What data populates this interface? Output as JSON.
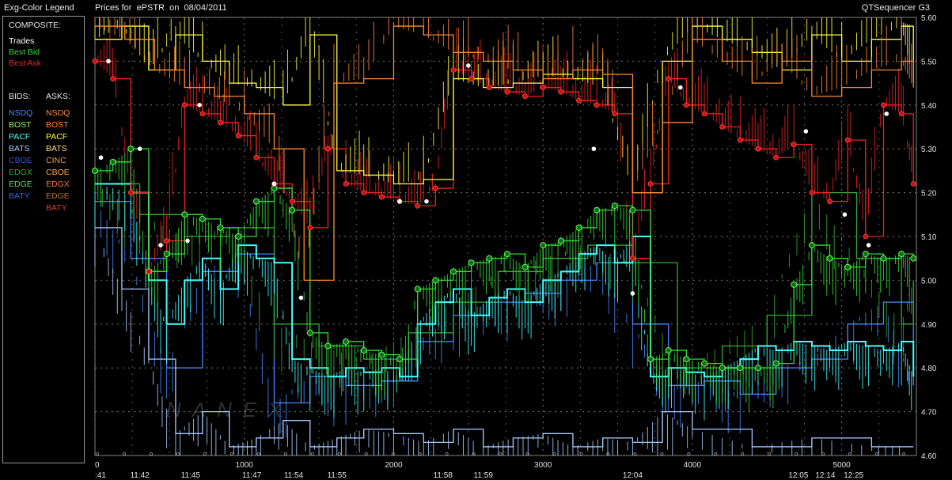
{
  "header": {
    "legend_title": "Exg-Color Legend",
    "chart_title": "Prices for  ePSTR  on  08/04/2011",
    "app_name": "QTSequencer G3"
  },
  "legend": {
    "composite_label": "COMPOSITE:",
    "composite": [
      {
        "label": "Trades",
        "color": "#ffffff"
      },
      {
        "label": "Best Bid",
        "color": "#33dd33"
      },
      {
        "label": "Best Ask",
        "color": "#ee2222"
      }
    ],
    "bids_label": "BIDS:",
    "asks_label": "ASKS:",
    "bids": [
      {
        "label": "NSDQ",
        "color": "#4488ff"
      },
      {
        "label": "BOST",
        "color": "#99ff66"
      },
      {
        "label": "PACF",
        "color": "#44ffff"
      },
      {
        "label": "BATS",
        "color": "#aaccff"
      },
      {
        "label": "CBOE",
        "color": "#3355cc"
      },
      {
        "label": "EDGX",
        "color": "#33aa33"
      },
      {
        "label": "EDGE",
        "color": "#55dd55"
      },
      {
        "label": "BATY",
        "color": "#3366dd"
      }
    ],
    "asks": [
      {
        "label": "NSDQ",
        "color": "#ff8833"
      },
      {
        "label": "BOST",
        "color": "#ff8855"
      },
      {
        "label": "PACF",
        "color": "#ffff44"
      },
      {
        "label": "BATS",
        "color": "#ffdd88"
      },
      {
        "label": "CINC",
        "color": "#ee9944"
      },
      {
        "label": "CBOE",
        "color": "#ffaa44"
      },
      {
        "label": "EDGX",
        "color": "#ee7744"
      },
      {
        "label": "EDGE",
        "color": "#dd6633"
      },
      {
        "label": "BATY",
        "color": "#cc4433"
      }
    ]
  },
  "watermark": "NANEX",
  "chart_data": {
    "type": "line",
    "title": "Prices for  ePSTR  on  08/04/2011",
    "ylim": [
      4.6,
      5.6
    ],
    "xlim": [
      0,
      5500
    ],
    "y_ticks": [
      "5.60",
      "5.50",
      "5.40",
      "5.30",
      "5.20",
      "5.10",
      "5.00",
      "4.90",
      "4.80",
      "4.70",
      "4.60"
    ],
    "x_ticks": [
      {
        "value": 0,
        "label": "0"
      },
      {
        "value": 1000,
        "label": "1000"
      },
      {
        "value": 2000,
        "label": "2000"
      },
      {
        "value": 3000,
        "label": "3000"
      },
      {
        "value": 4000,
        "label": "4000"
      },
      {
        "value": 5000,
        "label": "5000"
      }
    ],
    "time_labels": [
      {
        "x": 0,
        "label": ":41"
      },
      {
        "x": 300,
        "label": "11:42"
      },
      {
        "x": 640,
        "label": "11:45"
      },
      {
        "x": 1050,
        "label": "11:47"
      },
      {
        "x": 1330,
        "label": "11:54"
      },
      {
        "x": 1620,
        "label": "11:55"
      },
      {
        "x": 2330,
        "label": "11:58"
      },
      {
        "x": 2600,
        "label": "11:59"
      },
      {
        "x": 3600,
        "label": "12:04"
      },
      {
        "x": 4710,
        "label": "12:05"
      },
      {
        "x": 4890,
        "label": "12:14"
      },
      {
        "x": 5080,
        "label": "12:25"
      }
    ],
    "series": [
      {
        "name": "Best Ask",
        "color": "#ee2222",
        "x": [
          0,
          120,
          240,
          360,
          480,
          600,
          720,
          840,
          960,
          1080,
          1200,
          1320,
          1440,
          1560,
          1680,
          1800,
          1920,
          2040,
          2160,
          2280,
          2400,
          2520,
          2640,
          2760,
          2880,
          3000,
          3120,
          3240,
          3360,
          3480,
          3600,
          3720,
          3840,
          3960,
          4080,
          4200,
          4320,
          4440,
          4560,
          4680,
          4800,
          4920,
          5040,
          5160,
          5280,
          5400,
          5480
        ],
        "y": [
          5.5,
          5.46,
          5.2,
          5.02,
          5.09,
          5.4,
          5.38,
          5.36,
          5.33,
          5.28,
          5.22,
          5.18,
          5.12,
          5.3,
          5.22,
          5.2,
          5.19,
          5.18,
          5.17,
          5.21,
          5.48,
          5.46,
          5.44,
          5.43,
          5.42,
          5.44,
          5.43,
          5.41,
          5.4,
          5.38,
          5.05,
          5.22,
          5.46,
          5.4,
          5.38,
          5.35,
          5.32,
          5.3,
          5.28,
          5.31,
          5.2,
          5.18,
          5.32,
          5.1,
          5.4,
          5.38,
          5.22
        ]
      },
      {
        "name": "Best Bid",
        "color": "#33dd33",
        "x": [
          0,
          120,
          240,
          360,
          480,
          600,
          720,
          840,
          960,
          1080,
          1200,
          1320,
          1440,
          1560,
          1680,
          1800,
          1920,
          2040,
          2160,
          2280,
          2400,
          2520,
          2640,
          2760,
          2880,
          3000,
          3120,
          3240,
          3360,
          3480,
          3600,
          3720,
          3840,
          3960,
          4080,
          4200,
          4320,
          4440,
          4560,
          4680,
          4800,
          4920,
          5040,
          5160,
          5280,
          5400,
          5480
        ],
        "y": [
          5.25,
          5.27,
          5.3,
          5.02,
          5.06,
          5.15,
          5.14,
          5.12,
          5.1,
          5.18,
          5.21,
          5.16,
          4.88,
          4.85,
          4.86,
          4.84,
          4.83,
          4.82,
          4.98,
          5.0,
          5.02,
          5.04,
          5.05,
          5.06,
          5.03,
          5.08,
          5.09,
          5.12,
          5.16,
          5.17,
          5.16,
          4.82,
          4.84,
          4.82,
          4.81,
          4.8,
          4.8,
          4.8,
          4.81,
          4.99,
          5.08,
          5.05,
          5.03,
          5.06,
          5.05,
          5.06,
          5.05
        ]
      },
      {
        "name": "PACF",
        "color": "#44ffff",
        "x": [
          0,
          240,
          360,
          480,
          600,
          720,
          840,
          960,
          1080,
          1200,
          1320,
          1440,
          1560,
          1680,
          1800,
          1920,
          2040,
          2160,
          2280,
          2400,
          2520,
          2640,
          2760,
          2880,
          3000,
          3120,
          3240,
          3360,
          3480,
          3600,
          3720,
          3840,
          3960,
          4080,
          4200,
          4320,
          4440,
          4560,
          4680,
          4800,
          4920,
          5040,
          5160,
          5280,
          5400,
          5480
        ],
        "y": [
          5.22,
          5.2,
          5.0,
          4.9,
          5.0,
          5.05,
          4.98,
          5.08,
          5.05,
          5.04,
          4.82,
          4.8,
          4.78,
          4.8,
          4.79,
          4.8,
          4.78,
          4.9,
          4.95,
          4.98,
          4.92,
          4.96,
          4.98,
          4.95,
          5.0,
          5.02,
          5.06,
          5.08,
          5.04,
          5.1,
          4.78,
          4.8,
          4.79,
          4.78,
          4.8,
          4.82,
          4.85,
          4.84,
          4.86,
          4.85,
          4.84,
          4.86,
          4.85,
          4.84,
          4.86,
          4.78
        ]
      },
      {
        "name": "NSDQ",
        "color": "#4488ff",
        "x": [
          0,
          240,
          480,
          720,
          960,
          1200,
          1440,
          1680,
          1920,
          2160,
          2400,
          2640,
          2880,
          3120,
          3360,
          3600,
          3840,
          4080,
          4320,
          4560,
          4800,
          5040,
          5280,
          5480
        ],
        "y": [
          5.18,
          5.05,
          4.8,
          5.02,
          5.06,
          4.72,
          4.78,
          4.76,
          4.77,
          4.86,
          4.92,
          4.95,
          4.97,
          5.0,
          5.04,
          4.9,
          4.76,
          4.77,
          4.74,
          4.8,
          4.82,
          4.9,
          4.95,
          4.76
        ]
      },
      {
        "name": "BATS",
        "color": "#aaccff",
        "x": [
          0,
          180,
          360,
          540,
          720,
          900,
          1080,
          1260,
          1440,
          1620,
          1800,
          2000,
          2200,
          2400,
          2600,
          2800,
          3000,
          3200,
          3400,
          3600,
          3800,
          4000,
          4400,
          4800,
          5200,
          5480
        ],
        "y": [
          5.12,
          4.98,
          4.82,
          4.65,
          4.7,
          4.62,
          4.64,
          4.68,
          4.62,
          4.64,
          4.66,
          4.65,
          4.63,
          4.66,
          4.62,
          4.64,
          4.65,
          4.62,
          4.64,
          4.63,
          4.7,
          4.66,
          4.62,
          4.64,
          4.62,
          4.62
        ]
      },
      {
        "name": "PACF ask",
        "color": "#ffff44",
        "x": [
          0,
          180,
          360,
          540,
          720,
          900,
          1080,
          1260,
          1440,
          1620,
          1800,
          2000,
          2200,
          2400,
          2600,
          2800,
          3000,
          3200,
          3400,
          3600,
          3800,
          4000,
          4200,
          4400,
          4600,
          4800,
          5000,
          5200,
          5400,
          5480
        ],
        "y": [
          5.55,
          5.58,
          5.48,
          5.56,
          5.5,
          5.45,
          5.44,
          5.4,
          5.56,
          5.25,
          5.24,
          5.22,
          5.23,
          5.46,
          5.44,
          5.45,
          5.47,
          5.46,
          5.44,
          5.2,
          5.5,
          5.58,
          5.55,
          5.52,
          5.48,
          5.56,
          5.5,
          5.55,
          5.58,
          5.45
        ]
      },
      {
        "name": "NSDQ ask",
        "color": "#ff8833",
        "x": [
          0,
          200,
          400,
          600,
          800,
          1000,
          1200,
          1400,
          1600,
          1800,
          2000,
          2200,
          2400,
          2600,
          2800,
          3000,
          3200,
          3400,
          3600,
          3800,
          4000,
          4200,
          4400,
          4600,
          4800,
          5000,
          5200,
          5400,
          5480
        ],
        "y": [
          5.58,
          5.55,
          5.48,
          5.44,
          5.42,
          5.38,
          5.3,
          5.0,
          5.45,
          5.46,
          5.58,
          5.56,
          5.52,
          5.5,
          5.48,
          5.46,
          5.48,
          5.47,
          5.2,
          5.36,
          5.55,
          5.5,
          5.45,
          5.5,
          5.42,
          5.44,
          5.48,
          5.5,
          5.44
        ]
      },
      {
        "name": "EDGX",
        "color": "#33aa33",
        "x": [
          0,
          300,
          600,
          900,
          1200,
          1500,
          1800,
          2100,
          2400,
          2700,
          3000,
          3300,
          3600,
          3900,
          4200,
          4500,
          4800,
          5100,
          5400,
          5480
        ],
        "y": [
          5.22,
          5.15,
          5.1,
          5.12,
          4.9,
          4.85,
          4.82,
          4.88,
          4.95,
          5.02,
          5.05,
          5.08,
          5.04,
          4.8,
          4.85,
          4.92,
          5.2,
          5.05,
          4.9,
          5.0
        ]
      }
    ],
    "trades": [
      {
        "x": 40,
        "y": 5.28
      },
      {
        "x": 90,
        "y": 5.5
      },
      {
        "x": 300,
        "y": 5.3
      },
      {
        "x": 440,
        "y": 5.08
      },
      {
        "x": 620,
        "y": 5.09
      },
      {
        "x": 700,
        "y": 5.4
      },
      {
        "x": 1200,
        "y": 5.22
      },
      {
        "x": 1380,
        "y": 4.96
      },
      {
        "x": 2040,
        "y": 5.18
      },
      {
        "x": 2220,
        "y": 5.18
      },
      {
        "x": 2500,
        "y": 5.49
      },
      {
        "x": 3340,
        "y": 5.3
      },
      {
        "x": 3600,
        "y": 4.97
      },
      {
        "x": 3920,
        "y": 5.44
      },
      {
        "x": 4760,
        "y": 5.34
      },
      {
        "x": 5020,
        "y": 5.15
      },
      {
        "x": 5180,
        "y": 5.08
      },
      {
        "x": 5300,
        "y": 5.38
      }
    ]
  }
}
